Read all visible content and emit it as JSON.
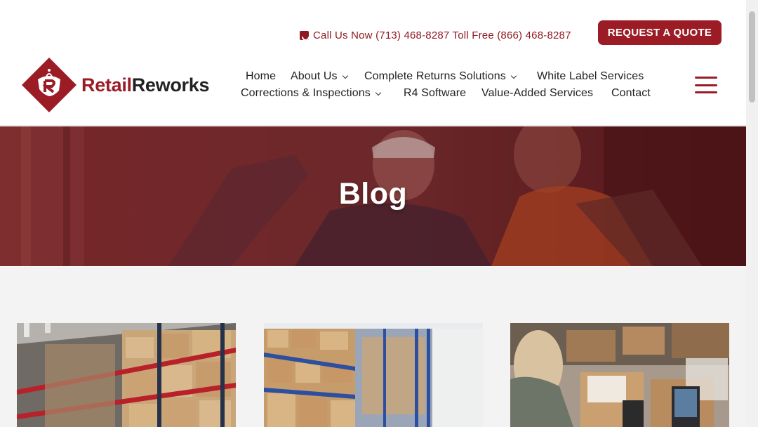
{
  "topbar": {
    "phone_text": "Call Us Now (713) 468-8287 Toll Free (866) 468-8287",
    "quote_button": "REQUEST A QUOTE"
  },
  "logo": {
    "part1": "Retail",
    "part2": "Reworks"
  },
  "nav": {
    "items": [
      {
        "label": "Home"
      },
      {
        "label": "About Us"
      },
      {
        "label": "Complete Returns Solutions"
      },
      {
        "label": "White Label Services"
      },
      {
        "label": "Corrections & Inspections"
      },
      {
        "label": "R4 Software"
      },
      {
        "label": "Value-Added Services"
      },
      {
        "label": "Contact"
      }
    ]
  },
  "hero": {
    "title": "Blog"
  },
  "colors": {
    "brand": "#9b1c25",
    "hero_overlay": "#6b1e22",
    "content_bg": "#f3f3f3"
  },
  "icons": [
    "phone-icon",
    "hamburger-menu-icon",
    "chevron-down-icon"
  ]
}
